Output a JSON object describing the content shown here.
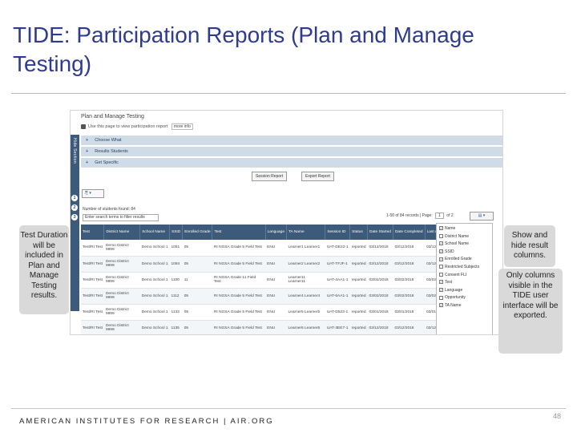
{
  "slide": {
    "title": "TIDE: Participation Reports (Plan and Manage Testing)",
    "footer": "AMERICAN INSTITUTES FOR RESEARCH | AIR.ORG",
    "page_number": "48"
  },
  "screenshot": {
    "heading": "Plan and Manage Testing",
    "subtitle": "Use this page to view participation report",
    "more_info": "more info",
    "side_tab_label": "Hide Section",
    "steps": [
      "1",
      "2",
      "3"
    ],
    "sections": [
      {
        "label": "Choose What"
      },
      {
        "label": "Results Students"
      },
      {
        "label": "Get Specific"
      }
    ],
    "session_report_button": "Session Report",
    "export_report_button": "Export Report",
    "export_control": "▾",
    "student_count": "Number of students found: 84",
    "search_placeholder": "Enter search terms to filter results",
    "pager": {
      "text": "1-50 of 84 records | Page:",
      "page": "1",
      "of": "of 2"
    },
    "column_toggle": "▾",
    "columns": [
      "Test",
      "District Name",
      "School Name",
      "SSID",
      "Enrolled Grade",
      "Test",
      "Language",
      "TA Name",
      "Session ID",
      "Status",
      "Date Started",
      "Date Completed",
      "Last Activity"
    ],
    "rows": [
      [
        "Test/RI Test",
        "Demo District 9999",
        "Demo School 1",
        "1051",
        "05",
        "RI NGSA Grade 5 Field Test",
        "ENU",
        "Learner1 Learner1",
        "UAT-DE22-1",
        "reported",
        "03/12/2018",
        "03/12/2018",
        "03/12"
      ],
      [
        "Test/RI Test",
        "Demo District 9999",
        "Demo School 1",
        "1084",
        "05",
        "RI NGSA Grade 5 Field Test",
        "ENU",
        "Learner2 Learner2",
        "UAT-TFJF-1",
        "reported",
        "03/12/2018",
        "03/12/2018",
        "03/12"
      ],
      [
        "Test/RI Test",
        "Demo District 9999",
        "Demo School 1",
        "1100",
        "11",
        "RI NGSA Grade 11 Field Test",
        "ENU",
        "Learner11 Learner11",
        "UAT-4AA1-1",
        "reported",
        "03/02/2018",
        "03/02/2018",
        "03/02"
      ],
      [
        "Test/RI Test",
        "Demo District 9999",
        "Demo School 1",
        "1112",
        "05",
        "RI NGSA Grade 5 Field Test",
        "ENU",
        "Learner4 Learner4",
        "UAT-6AA1-1",
        "reported",
        "03/02/2018",
        "03/02/2018",
        "03/02"
      ],
      [
        "Test/RI Test",
        "Demo District 9999",
        "Demo School 1",
        "1133",
        "05",
        "RI NGSA Grade 5 Field Test",
        "ENU",
        "Learner5 Learner5",
        "UAT-D523-1",
        "reported",
        "03/01/2018",
        "03/01/2018",
        "03/01"
      ],
      [
        "Test/RI Test",
        "Demo District 9999",
        "Demo School 1",
        "1135",
        "05",
        "RI NGSA Grade 5 Field Test",
        "ENU",
        "Learner6 Learner6",
        "UAT-3EE7-1",
        "reported",
        "03/12/2018",
        "03/12/2018",
        "03/12"
      ]
    ],
    "column_options": [
      {
        "label": "Name",
        "checked": true
      },
      {
        "label": "District Name",
        "checked": false
      },
      {
        "label": "School Name",
        "checked": true
      },
      {
        "label": "SSID",
        "checked": true
      },
      {
        "label": "Enrolled Grade",
        "checked": true
      },
      {
        "label": "Restricted Subjects",
        "checked": false
      },
      {
        "label": "Consent FLI",
        "checked": false
      },
      {
        "label": "Test",
        "checked": true
      },
      {
        "label": "Language",
        "checked": true
      },
      {
        "label": "Opportunity",
        "checked": false
      },
      {
        "label": "TA Name",
        "checked": true
      }
    ]
  },
  "callouts": {
    "left": "Test Duration will be included in Plan and Manage Testing results.",
    "right_top": "Show and hide result columns.",
    "right_bottom": "Only columns visible in the TIDE user interface will be exported."
  }
}
